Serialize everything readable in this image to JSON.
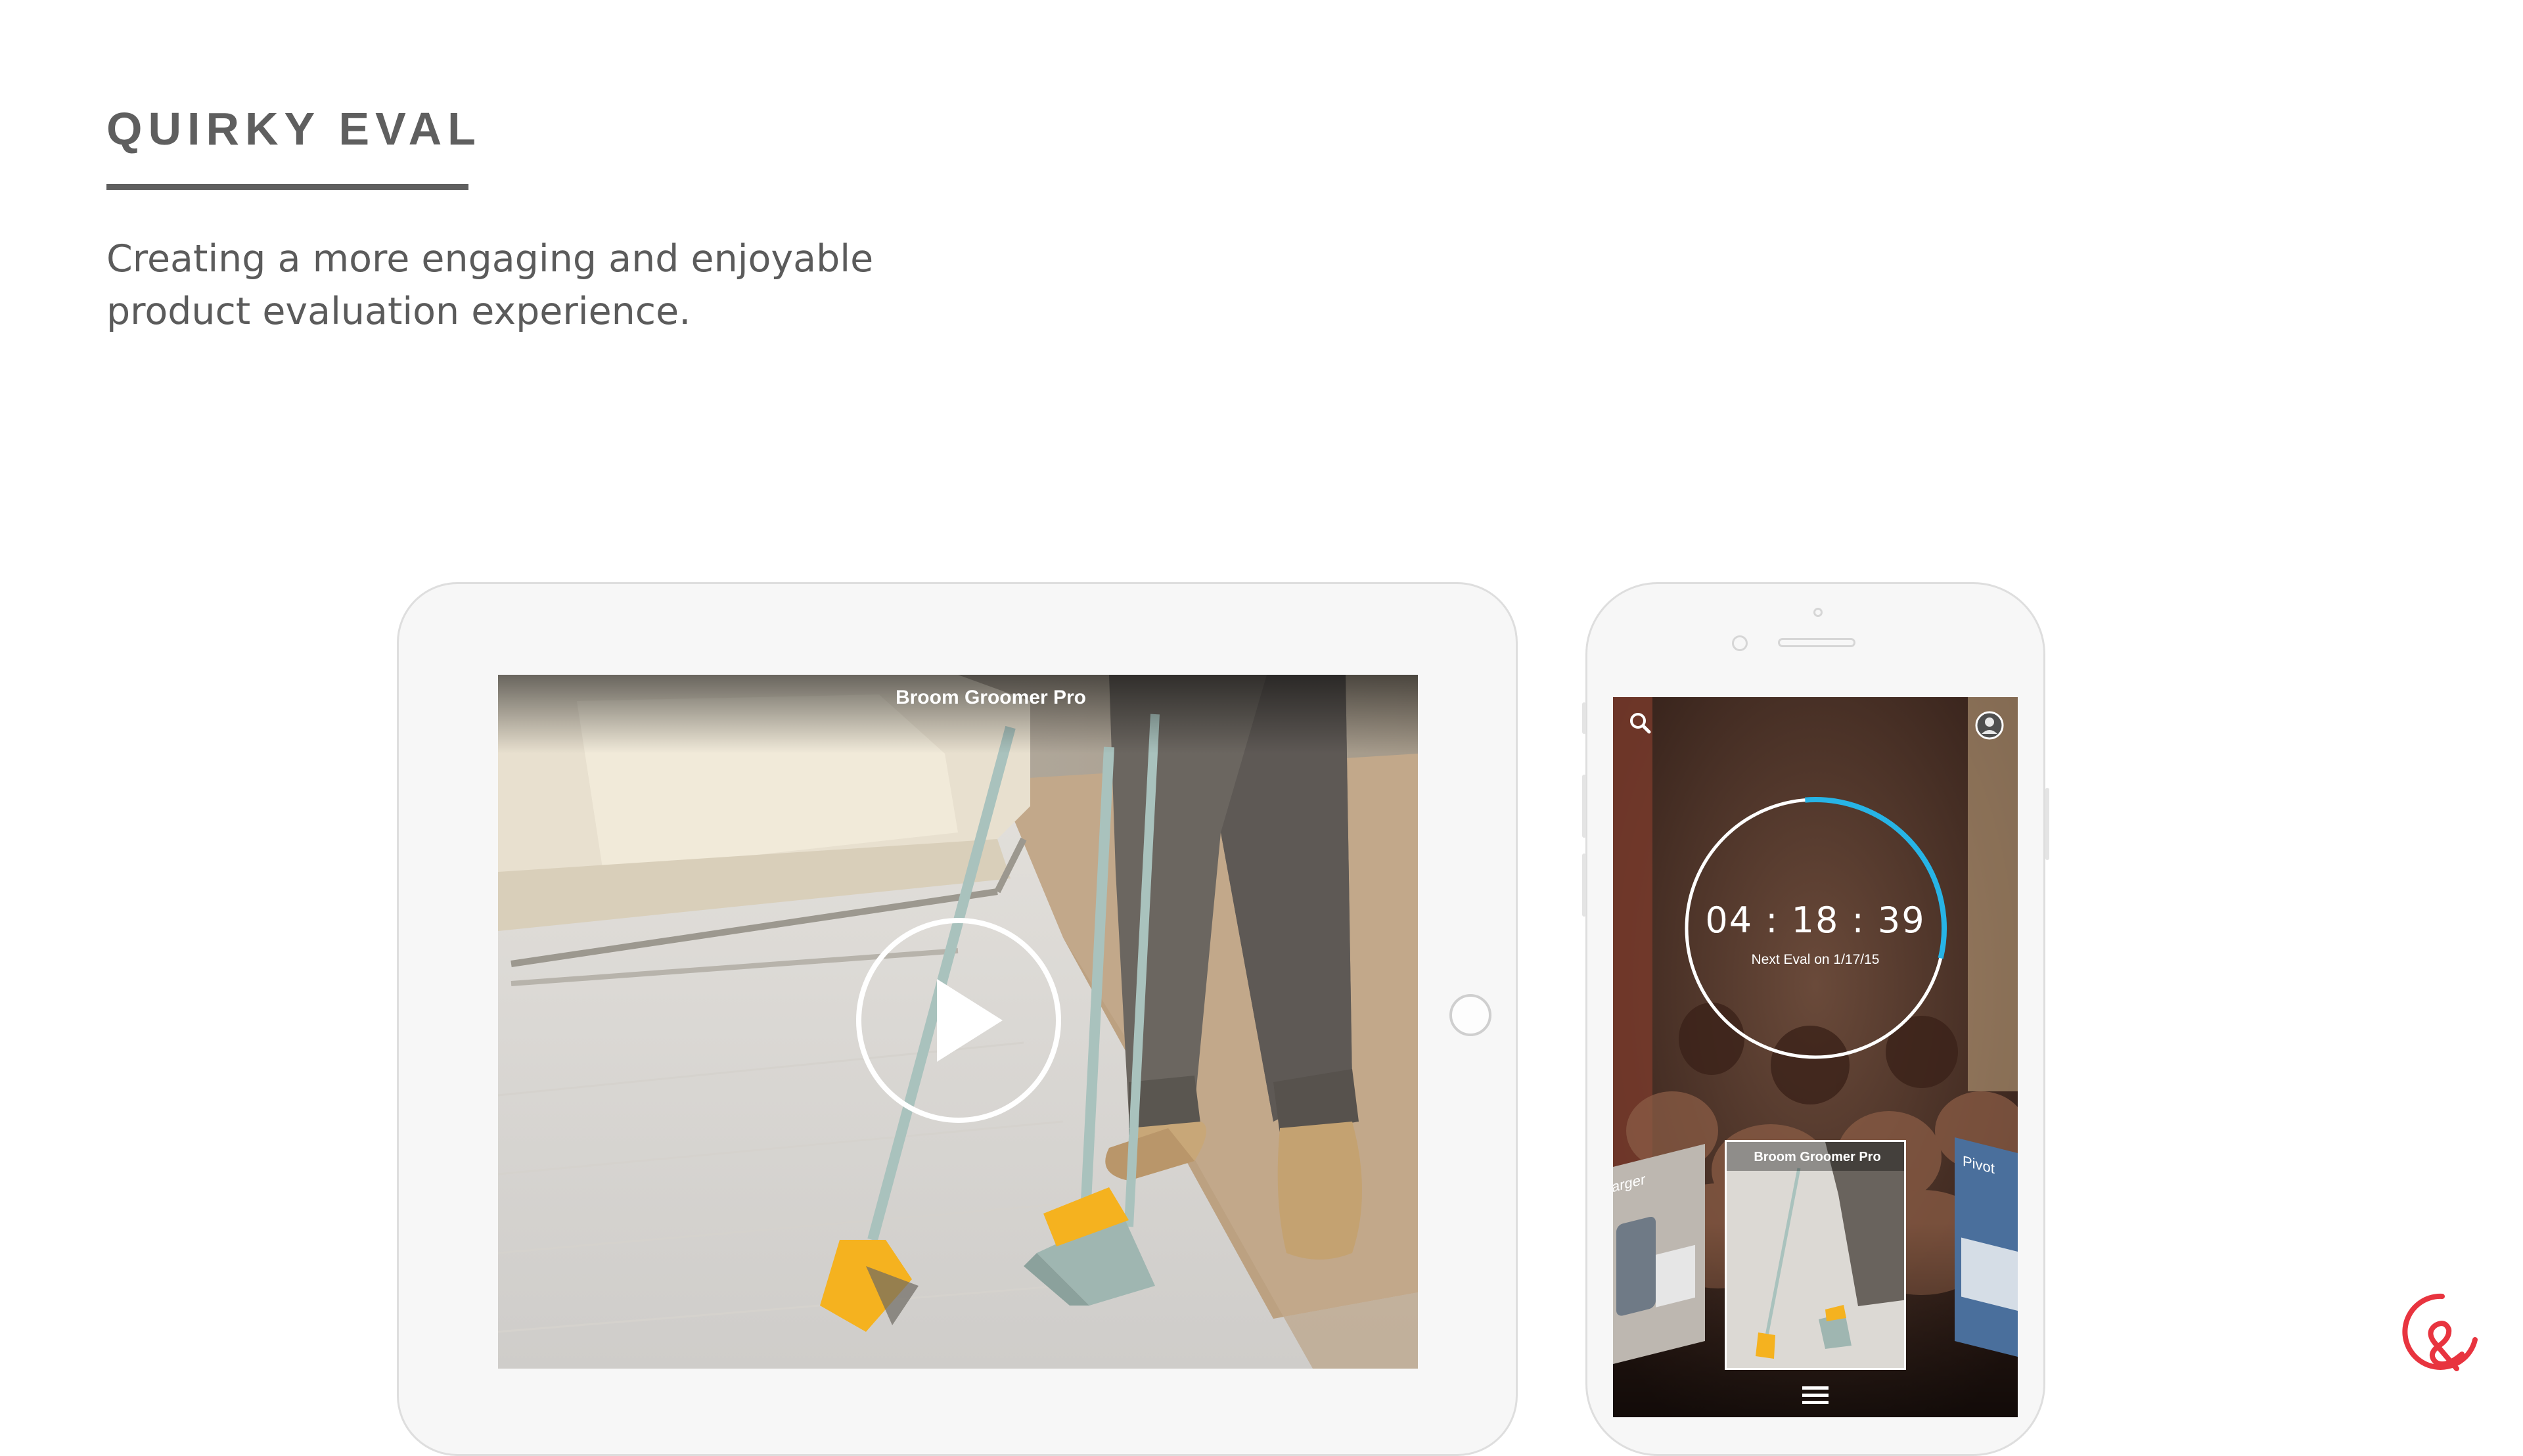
{
  "header": {
    "title": "QUIRKY EVAL",
    "subtitle_line1": "Creating a more engaging and enjoyable",
    "subtitle_line2": "product evaluation experience."
  },
  "tablet": {
    "video_title": "Broom Groomer Pro",
    "play_icon": "play-icon"
  },
  "phone": {
    "timer": "04 : 18 : 39",
    "next_eval": "Next Eval on 1/17/15",
    "countdown_progress": 0.3,
    "cards": [
      {
        "label": "arger"
      },
      {
        "label": "Broom Groomer Pro"
      },
      {
        "label": "Pivot"
      }
    ],
    "icons": [
      "search-icon",
      "avatar-icon",
      "menu-icon"
    ]
  },
  "colors": {
    "heading": "#5f5f5f",
    "text": "#5b5b5b",
    "device_frame": "#f7f7f7",
    "timer_accent": "#27b4e6",
    "logo_red": "#e8343f",
    "broom_yellow": "#f5b21f"
  }
}
